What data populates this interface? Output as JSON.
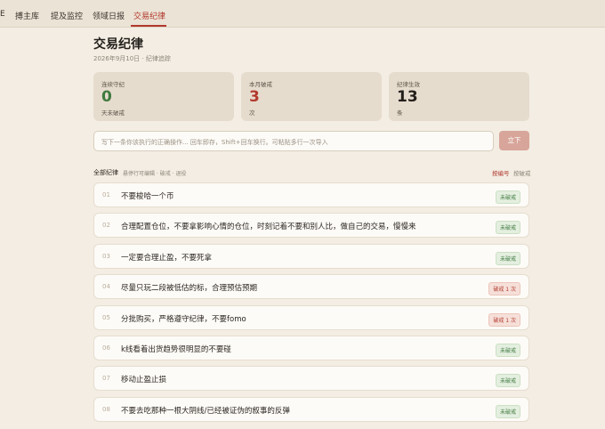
{
  "topbar": {
    "tabs": [
      {
        "label": "E"
      },
      {
        "label": "搏主库"
      },
      {
        "label": "提及监控"
      },
      {
        "label": "领域日报"
      },
      {
        "label": "交易纪律"
      }
    ]
  },
  "page": {
    "title": "交易纪律",
    "subtitle": "2026年9月10日 · 纪律追踪"
  },
  "stats": [
    {
      "label": "连续守纪",
      "value": "0",
      "unit": "天未破戒",
      "color": "#3f7a3f"
    },
    {
      "label": "本月破戒",
      "value": "3",
      "unit": "次",
      "color": "#b23a2e"
    },
    {
      "label": "纪律生效",
      "value": "13",
      "unit": "条",
      "color": "#231f1b"
    }
  ],
  "input": {
    "placeholder": "写下一条你该执行的正确操作... 回车即存，Shift+回车换行。可粘贴多行一次导入",
    "submit": "立下"
  },
  "list": {
    "heading": "全部纪律",
    "hint": "悬停行可编辑 · 破戒 · 退役",
    "sort_by_number": "按编号",
    "sort_by_breaks": "按破戒"
  },
  "rules": [
    {
      "num": "01",
      "text": "不要梭哈一个币",
      "badge": "未破戒",
      "status": "ok"
    },
    {
      "num": "02",
      "text": "合理配置仓位，不要拿影响心情的仓位，时刻记着不要和别人比，做自己的交易，慢慢来",
      "badge": "未破戒",
      "status": "ok"
    },
    {
      "num": "03",
      "text": "一定要合理止盈，不要死拿",
      "badge": "未破戒",
      "status": "ok"
    },
    {
      "num": "04",
      "text": "尽量只玩二段被低估的标，合理预估预期",
      "badge": "破戒 1 次",
      "status": "broken"
    },
    {
      "num": "05",
      "text": "分批购买，严格遵守纪律，不要fomo",
      "badge": "破戒 1 次",
      "status": "broken"
    },
    {
      "num": "06",
      "text": "k线看着出货趋势很明显的不要碰",
      "badge": "未破戒",
      "status": "ok"
    },
    {
      "num": "07",
      "text": "移动止盈止损",
      "badge": "未破戒",
      "status": "ok"
    },
    {
      "num": "08",
      "text": "不要去吃那种一根大阴线/已经被证伪的叙事的反弹",
      "badge": "未破戒",
      "status": "ok"
    }
  ]
}
